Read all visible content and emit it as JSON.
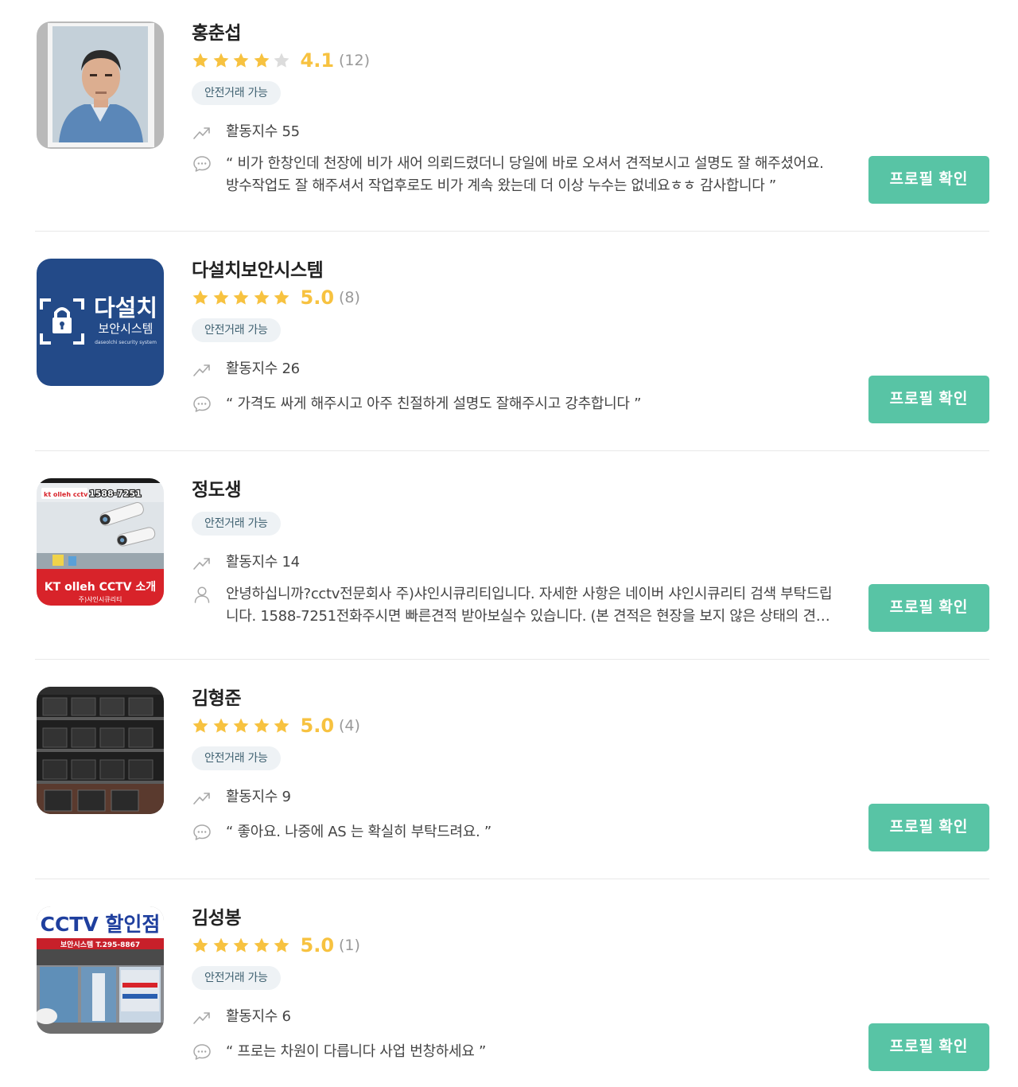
{
  "cta_label": "프로필 확인",
  "colors": {
    "accent": "#58c4a5",
    "star": "#f7c240",
    "star_empty": "#dcdcdc",
    "badge_bg": "#eef2f5"
  },
  "providers": [
    {
      "name": "홍춘섭",
      "rating": "4.1",
      "rating_value": 4.1,
      "review_count": "(12)",
      "badge": "안전거래 가능",
      "activity_icon": "trending-up-icon",
      "activity": "활동지수 55",
      "quote_icon": "speech-bubble-icon",
      "quote": "“ 비가 한창인데 천장에 비가 새어 의뢰드렸더니 당일에 바로 오셔서 견적보시고 설명도 잘 해주셨어요. 방수작업도 잘 해주셔서 작업후로도 비가 계속 왔는데 더 이상 누수는 없네요ㅎㅎ 감사합니다 ”",
      "photo": "portrait-photo"
    },
    {
      "name": "다설치보안시스템",
      "rating": "5.0",
      "rating_value": 5.0,
      "review_count": "(8)",
      "badge": "안전거래 가능",
      "activity_icon": "trending-up-icon",
      "activity": "활동지수 26",
      "quote_icon": "speech-bubble-icon",
      "quote": "“ 가격도 싸게 해주시고 아주 친절하게 설명도 잘해주시고 강추합니다 ”",
      "photo": "daseolchi-logo",
      "logo_title": "다설치",
      "logo_sub": "보안시스템",
      "logo_en": "daseolchi security system"
    },
    {
      "name": "정도생",
      "badge": "안전거래 가능",
      "activity_icon": "trending-up-icon",
      "activity": "활동지수 14",
      "quote_icon": "user-icon",
      "quote": "안녕하십니까?cctv전문회사 주)샤인시큐리티입니다. 자세한 사항은 네이버 샤인시큐리티 검색 부탁드립니다. 1588-7251전화주시면 빠른견적 받아보실수 있습니다. (본 견적은 현장을 보지 않은 상태의 견적입니다)",
      "photo": "kt-olleh-cctv-banner",
      "banner_brand": "kt olleh cctv",
      "banner_phone": "1588-7251",
      "banner_title": "KT olleh CCTV 소개",
      "banner_sub": "주)샤인시큐리티"
    },
    {
      "name": "김형준",
      "rating": "5.0",
      "rating_value": 5.0,
      "review_count": "(4)",
      "badge": "안전거래 가능",
      "activity_icon": "trending-up-icon",
      "activity": "활동지수 9",
      "quote_icon": "speech-bubble-icon",
      "quote": "“ 좋아요. 나중에 AS 는 확실히 부탁드려요. ”",
      "photo": "warehouse-shelves-photo"
    },
    {
      "name": "김성봉",
      "rating": "5.0",
      "rating_value": 5.0,
      "review_count": "(1)",
      "badge": "안전거래 가능",
      "activity_icon": "trending-up-icon",
      "activity": "활동지수 6",
      "quote_icon": "speech-bubble-icon",
      "quote": "“ 프로는 차원이 다릅니다 사업 번창하세요 ”",
      "photo": "cctv-shop-storefront-photo",
      "sign_title": "CCTV 할인점",
      "sign_sub": "보안시스템 T.295-8867"
    }
  ]
}
